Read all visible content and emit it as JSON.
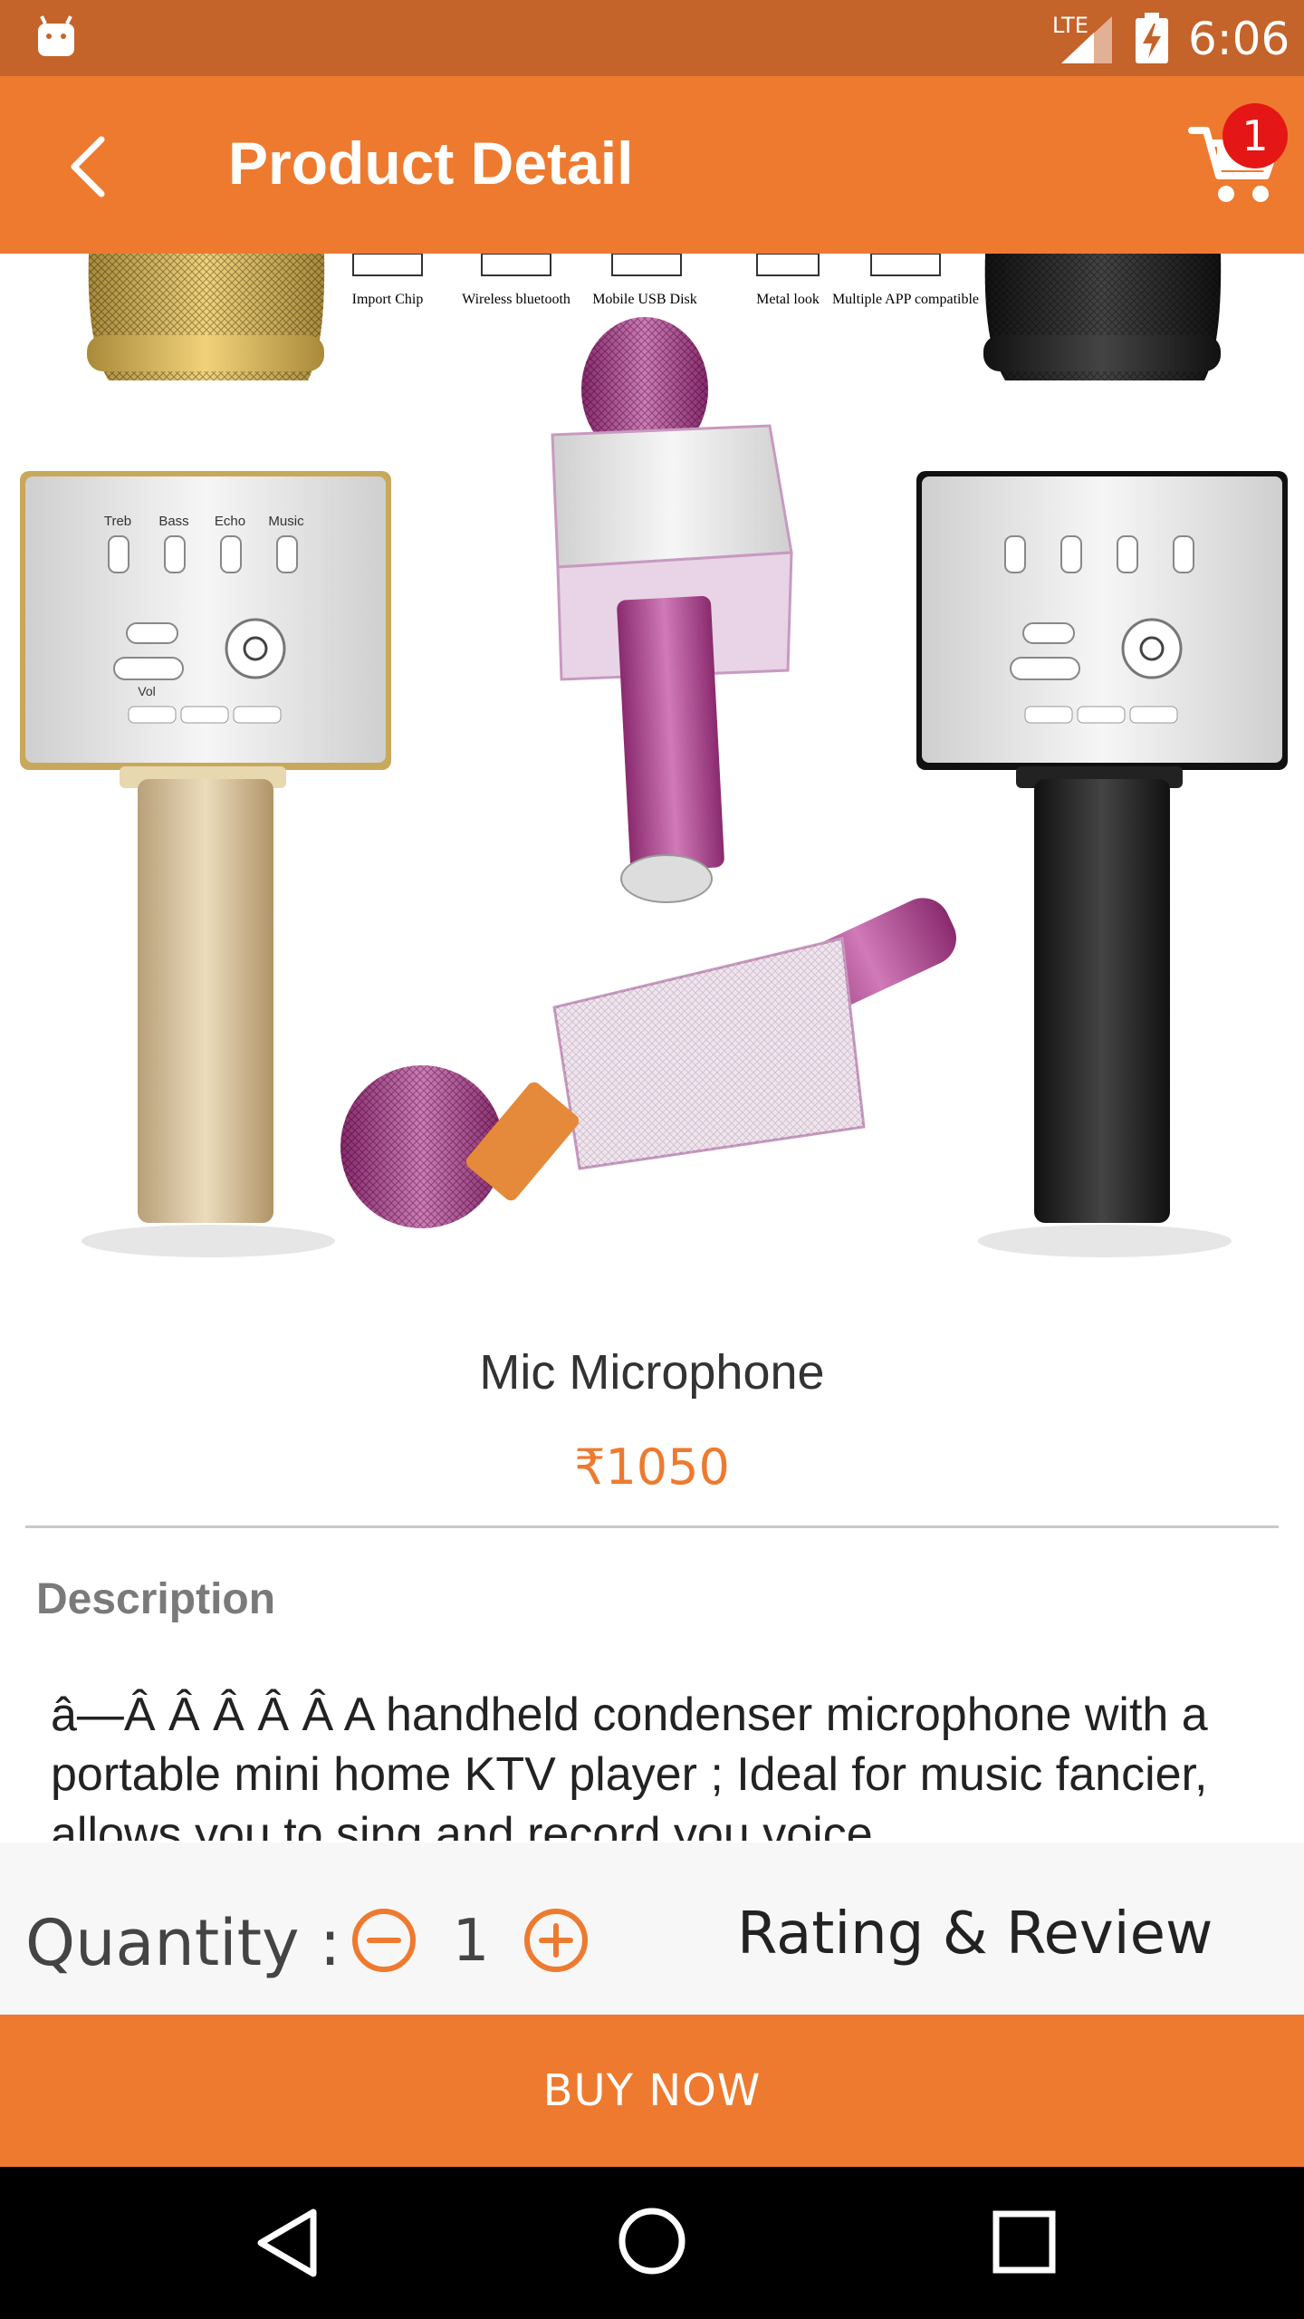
{
  "status_bar": {
    "network": "LTE",
    "time": "6:06"
  },
  "header": {
    "title": "Product Detail",
    "cart_count": "1"
  },
  "product_image": {
    "feature_labels": [
      "Import Chip",
      "Wireless bluetooth",
      "Mobile USB Disk",
      "Metal look",
      "Multiple APP compatible"
    ],
    "panel_labels": [
      "Treb",
      "Bass",
      "Echo",
      "Music"
    ],
    "vol_label": "Vol"
  },
  "product": {
    "name": "Mic Microphone",
    "price": "₹1050"
  },
  "description": {
    "heading": "Description",
    "text": "â—Â Â Â Â Â  A handheld condenser microphone with a portable mini home KTV player ; Ideal for music fancier, allows you to sing and record you voice"
  },
  "quantity": {
    "label": "Quantity :",
    "value": "1"
  },
  "rating_review_label": "Rating & Review",
  "buy_now_label": "BUY NOW",
  "colors": {
    "primary": "#ee7a2f",
    "status_bar": "#c4632a",
    "badge": "#e51616"
  },
  "icons": [
    "android-icon",
    "signal-icon",
    "battery-icon",
    "back-arrow-icon",
    "cart-icon",
    "minus-circle-icon",
    "plus-circle-icon",
    "nav-back-icon",
    "nav-home-icon",
    "nav-recents-icon"
  ]
}
